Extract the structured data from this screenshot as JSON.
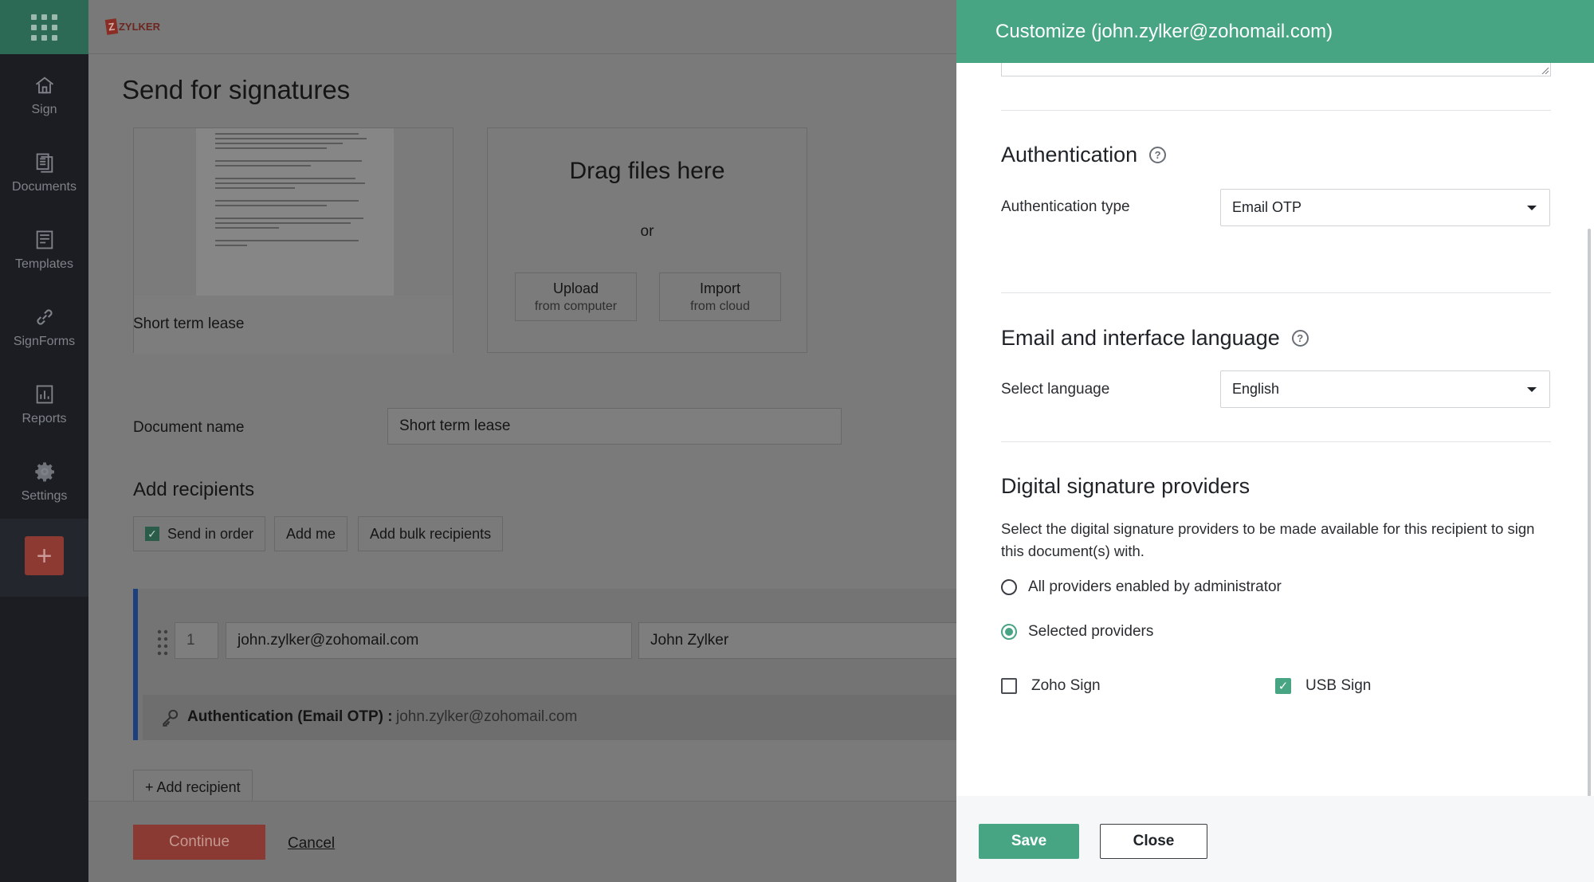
{
  "app": {
    "logo_text": "ZYLKER",
    "logo_mark": "Z"
  },
  "nav": {
    "items": [
      {
        "label": "Sign",
        "icon": "home-icon"
      },
      {
        "label": "Documents",
        "icon": "documents-icon"
      },
      {
        "label": "Templates",
        "icon": "templates-icon"
      },
      {
        "label": "SignForms",
        "icon": "link-icon"
      },
      {
        "label": "Reports",
        "icon": "reports-icon"
      },
      {
        "label": "Settings",
        "icon": "gear-icon"
      }
    ],
    "plus_label": "+"
  },
  "main": {
    "title": "Send for signatures",
    "document_card_name": "Short term lease",
    "drag_title": "Drag files here",
    "drag_or": "or",
    "upload": {
      "label": "Upload",
      "sub": "from computer"
    },
    "import": {
      "label": "Import",
      "sub": "from cloud"
    },
    "document_name_label": "Document name",
    "document_name_value": "Short term lease",
    "add_recipients_heading": "Add recipients",
    "send_in_order_label": "Send in order",
    "add_me_label": "Add me",
    "add_bulk_label": "Add bulk recipients",
    "recipient": {
      "order": "1",
      "email": "john.zylker@zohomail.com",
      "name": "John Zylker",
      "auth_label": "Authentication (Email OTP) :",
      "auth_value": "john.zylker@zohomail.com"
    },
    "add_recipient_label": "+ Add recipient",
    "continue_label": "Continue",
    "cancel_label": "Cancel"
  },
  "panel": {
    "title": "Customize (john.zylker@zohomail.com)",
    "authentication": {
      "heading": "Authentication",
      "type_label": "Authentication type",
      "type_value": "Email OTP"
    },
    "language": {
      "heading": "Email and interface language",
      "select_label": "Select language",
      "select_value": "English"
    },
    "providers": {
      "heading": "Digital signature providers",
      "description": "Select the digital signature providers to be made available for this recipient to sign this document(s) with.",
      "radio_all": "All providers enabled by administrator",
      "radio_selected": "Selected providers",
      "selected_option": "Selected providers",
      "zoho_sign_label": "Zoho Sign",
      "zoho_sign_checked": false,
      "usb_sign_label": "USB Sign",
      "usb_sign_checked": true
    },
    "save_label": "Save",
    "close_label": "Close"
  },
  "colors": {
    "accent": "#47a583",
    "nav_bg": "#1b1d22",
    "recipient_bar": "#1c3f7d",
    "danger": "#d9534f"
  }
}
